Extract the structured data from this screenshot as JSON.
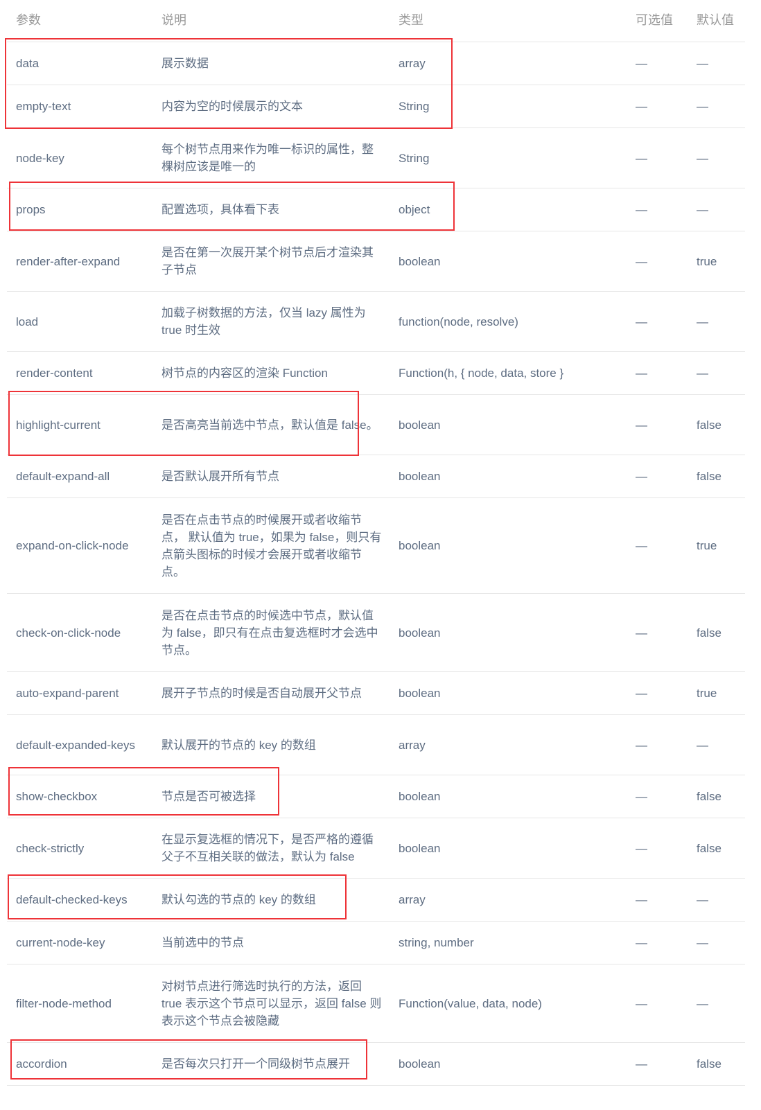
{
  "table": {
    "headers": {
      "param": "参数",
      "desc": "说明",
      "type": "类型",
      "options": "可选值",
      "default": "默认值"
    },
    "rows": [
      {
        "param": "data",
        "desc": "展示数据",
        "type": "array",
        "options": "—",
        "default": "—",
        "highlighted": true
      },
      {
        "param": "empty-text",
        "desc": "内容为空的时候展示的文本",
        "type": "String",
        "options": "—",
        "default": "—",
        "highlighted": true
      },
      {
        "param": "node-key",
        "desc": "每个树节点用来作为唯一标识的属性，整棵树应该是唯一的",
        "type": "String",
        "options": "—",
        "default": "—",
        "highlighted": false
      },
      {
        "param": "props",
        "desc": "配置选项，具体看下表",
        "type": "object",
        "options": "—",
        "default": "—",
        "highlighted": true
      },
      {
        "param": "render-after-expand",
        "desc": "是否在第一次展开某个树节点后才渲染其子节点",
        "type": "boolean",
        "options": "—",
        "default": "true",
        "highlighted": false
      },
      {
        "param": "load",
        "desc": "加载子树数据的方法，仅当 lazy 属性为true 时生效",
        "type": "function(node, resolve)",
        "options": "—",
        "default": "—",
        "highlighted": false
      },
      {
        "param": "render-content",
        "desc": "树节点的内容区的渲染 Function",
        "type": "Function(h, { node, data, store }",
        "options": "—",
        "default": "—",
        "highlighted": false
      },
      {
        "param": "highlight-current",
        "desc": "是否高亮当前选中节点，默认值是 false。",
        "type": "boolean",
        "options": "—",
        "default": "false",
        "highlighted": true
      },
      {
        "param": "default-expand-all",
        "desc": "是否默认展开所有节点",
        "type": "boolean",
        "options": "—",
        "default": "false",
        "highlighted": false
      },
      {
        "param": "expand-on-click-node",
        "desc": "是否在点击节点的时候展开或者收缩节点， 默认值为 true，如果为 false，则只有点箭头图标的时候才会展开或者收缩节点。",
        "type": "boolean",
        "options": "—",
        "default": "true",
        "highlighted": false
      },
      {
        "param": "check-on-click-node",
        "desc": "是否在点击节点的时候选中节点，默认值为 false，即只有在点击复选框时才会选中节点。",
        "type": "boolean",
        "options": "—",
        "default": "false",
        "highlighted": false
      },
      {
        "param": "auto-expand-parent",
        "desc": "展开子节点的时候是否自动展开父节点",
        "type": "boolean",
        "options": "—",
        "default": "true",
        "highlighted": false
      },
      {
        "param": "default-expanded-keys",
        "desc": "默认展开的节点的 key 的数组",
        "type": "array",
        "options": "—",
        "default": "—",
        "highlighted": false
      },
      {
        "param": "show-checkbox",
        "desc": "节点是否可被选择",
        "type": "boolean",
        "options": "—",
        "default": "false",
        "highlighted": true
      },
      {
        "param": "check-strictly",
        "desc": "在显示复选框的情况下，是否严格的遵循父子不互相关联的做法，默认为 false",
        "type": "boolean",
        "options": "—",
        "default": "false",
        "highlighted": false
      },
      {
        "param": "default-checked-keys",
        "desc": "默认勾选的节点的 key 的数组",
        "type": "array",
        "options": "—",
        "default": "—",
        "highlighted": true
      },
      {
        "param": "current-node-key",
        "desc": "当前选中的节点",
        "type": "string, number",
        "options": "—",
        "default": "—",
        "highlighted": false
      },
      {
        "param": "filter-node-method",
        "desc": "对树节点进行筛选时执行的方法，返回 true 表示这个节点可以显示，返回 false 则表示这个节点会被隐藏",
        "type": "Function(value, data, node)",
        "options": "—",
        "default": "—",
        "highlighted": false
      },
      {
        "param": "accordion",
        "desc": "是否每次只打开一个同级树节点展开",
        "type": "boolean",
        "options": "—",
        "default": "false",
        "highlighted": true
      }
    ]
  },
  "highlight_color": "#ee3338"
}
